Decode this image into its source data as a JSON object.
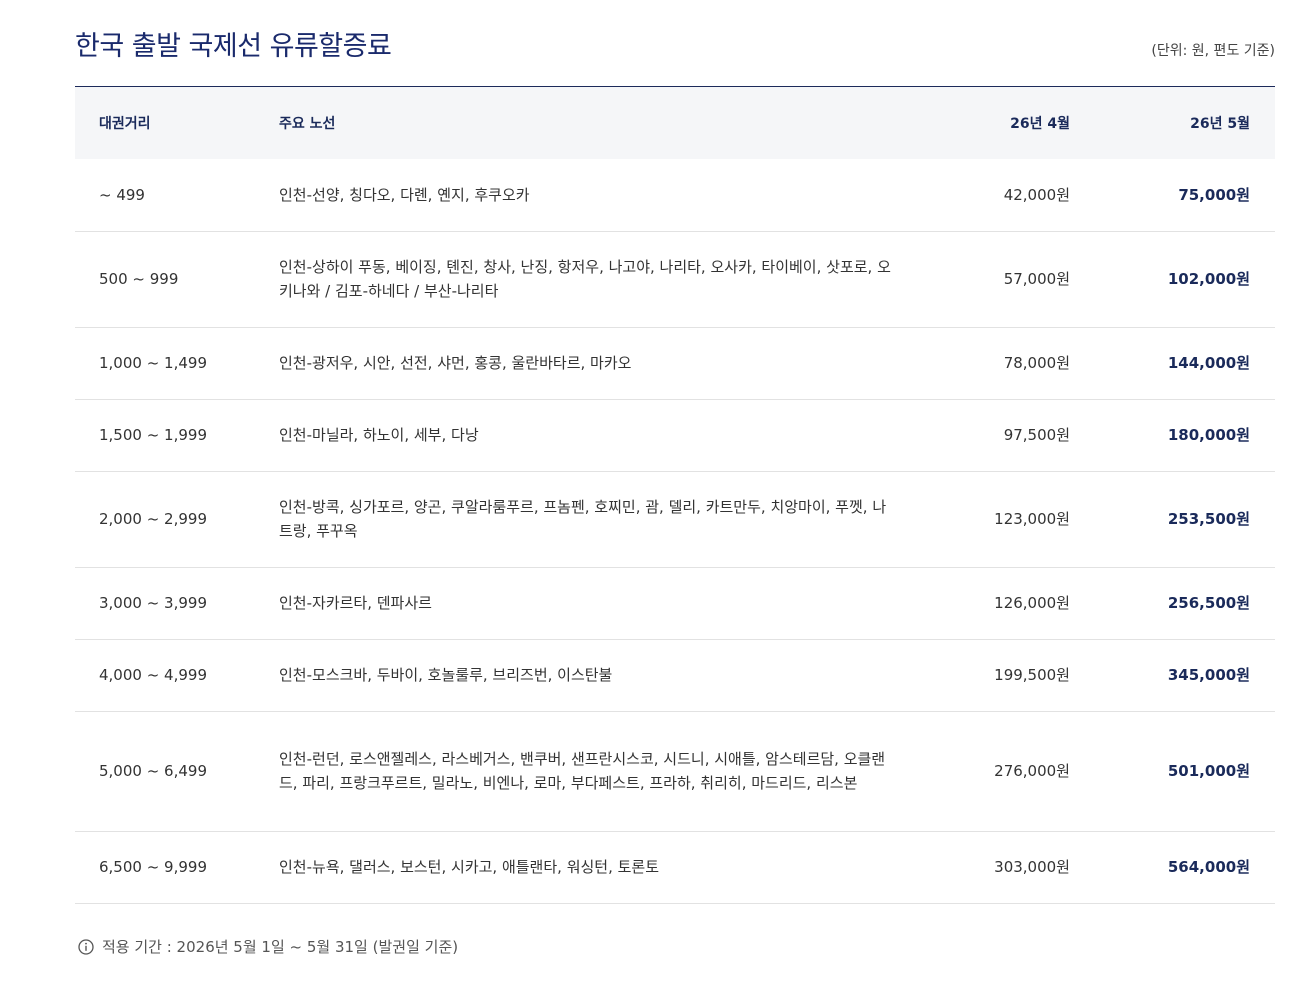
{
  "page": {
    "title": "한국 출발 국제선 유류할증료",
    "unit_note": "(단위: 원, 편도 기준)"
  },
  "table": {
    "headers": {
      "distance": "대권거리",
      "routes": "주요 노선",
      "april": "26년 4월",
      "may": "26년 5월"
    },
    "rows": [
      {
        "distance": "~ 499",
        "routes": "인천-선양, 칭다오, 다롄, 옌지, 후쿠오카",
        "april": "42,000원",
        "may": "75,000원",
        "lines": 1
      },
      {
        "distance": "500 ~ 999",
        "routes": "인천-상하이 푸동, 베이징, 톈진, 창사, 난징, 항저우, 나고야, 나리타, 오사카, 타이베이, 삿포로, 오키나와 / 김포-하네다 / 부산-나리타",
        "april": "57,000원",
        "may": "102,000원",
        "lines": 2
      },
      {
        "distance": "1,000 ~ 1,499",
        "routes": "인천-광저우, 시안, 선전, 샤먼, 홍콩, 울란바타르, 마카오",
        "april": "78,000원",
        "may": "144,000원",
        "lines": 1
      },
      {
        "distance": "1,500 ~ 1,999",
        "routes": "인천-마닐라, 하노이, 세부, 다낭",
        "april": "97,500원",
        "may": "180,000원",
        "lines": 1
      },
      {
        "distance": "2,000 ~ 2,999",
        "routes": "인천-방콕, 싱가포르, 양곤, 쿠알라룸푸르, 프놈펜, 호찌민, 괌, 델리, 카트만두, 치앙마이, 푸껫, 나트랑, 푸꾸옥",
        "april": "123,000원",
        "may": "253,500원",
        "lines": 2
      },
      {
        "distance": "3,000 ~ 3,999",
        "routes": "인천-자카르타, 덴파사르",
        "april": "126,000원",
        "may": "256,500원",
        "lines": 1
      },
      {
        "distance": "4,000 ~ 4,999",
        "routes": "인천-모스크바, 두바이, 호놀룰루, 브리즈번, 이스탄불",
        "april": "199,500원",
        "may": "345,000원",
        "lines": 1
      },
      {
        "distance": "5,000 ~ 6,499",
        "routes": "인천-런던, 로스앤젤레스, 라스베거스, 밴쿠버, 샌프란시스코, 시드니, 시애틀, 암스테르담, 오클랜드, 파리, 프랑크푸르트, 밀라노, 비엔나, 로마, 부다페스트, 프라하, 취리히, 마드리드, 리스본",
        "april": "276,000원",
        "may": "501,000원",
        "lines": 3
      },
      {
        "distance": "6,500 ~ 9,999",
        "routes": "인천-뉴욕, 댈러스, 보스턴, 시카고, 애틀랜타, 워싱턴, 토론토",
        "april": "303,000원",
        "may": "564,000원",
        "lines": 1
      }
    ]
  },
  "footnote": {
    "icon": "info-circle-icon",
    "text": "적용 기간 : 2026년 5월 1일 ~ 5월 31일 (발권일 기준)"
  },
  "colors": {
    "title": "#1a2a6c",
    "header_bg": "#f5f6f8",
    "emphasis": "#1a2a5a",
    "divider": "#e2e2e2"
  }
}
